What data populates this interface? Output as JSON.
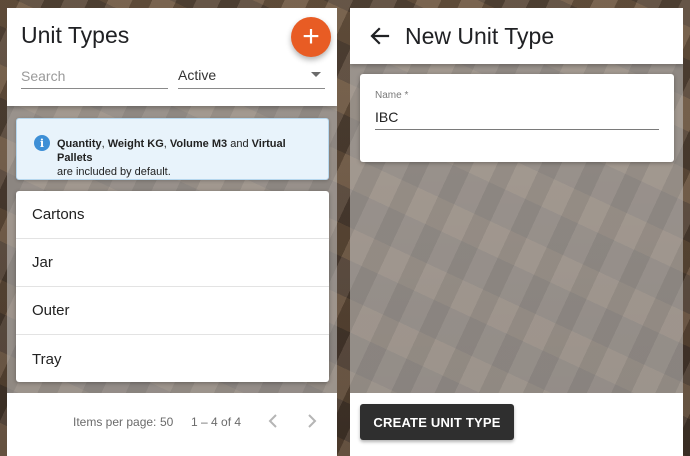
{
  "left_panel": {
    "title": "Unit Types",
    "add_icon": "plus-icon",
    "add_label": "+",
    "search": {
      "placeholder": "Search",
      "value": ""
    },
    "status_filter": {
      "selected": "Active"
    },
    "info": {
      "icon": "info-icon",
      "icon_glyph": "i",
      "part1": "Quantity",
      "sep1": ", ",
      "part2": "Weight KG",
      "sep2": ", ",
      "part3": "Volume M3",
      "sep3": " and ",
      "part4": "Virtual Pallets",
      "tail": "are included by default."
    },
    "items": [
      {
        "label": "Cartons"
      },
      {
        "label": "Jar"
      },
      {
        "label": "Outer"
      },
      {
        "label": "Tray"
      }
    ],
    "paginator": {
      "items_per_page_label": "Items per page:",
      "page_size": "50",
      "range": "1 – 4 of 4",
      "prev_icon": "chevron-left-icon",
      "next_icon": "chevron-right-icon"
    }
  },
  "right_panel": {
    "title": "New Unit Type",
    "back_icon": "arrow-left-icon",
    "name_label": "Name *",
    "name_value": "IBC",
    "create_button": "CREATE UNIT TYPE"
  },
  "colors": {
    "accent": "#e85c24",
    "info_bg": "#e8f3fb",
    "info_icon": "#3d8fd6",
    "button_dark": "#2f2f2f"
  }
}
